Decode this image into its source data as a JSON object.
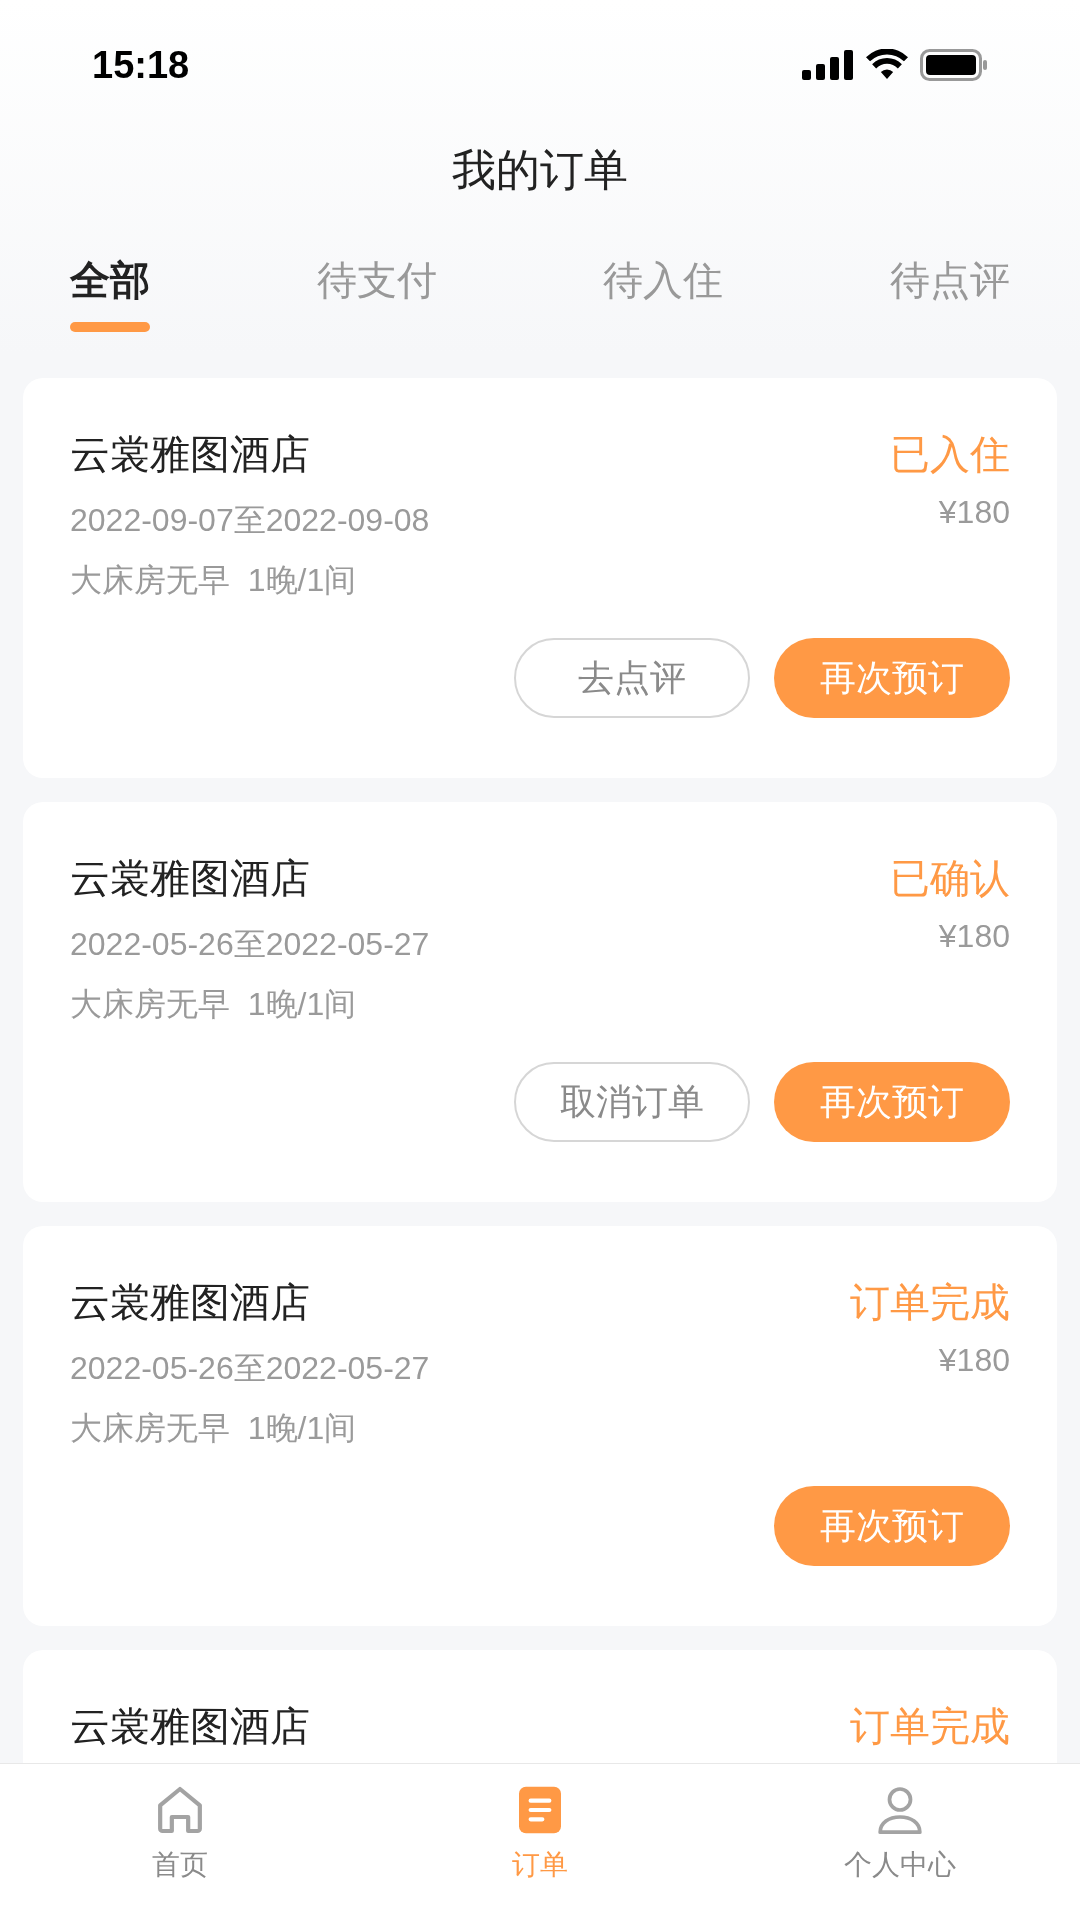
{
  "status_bar": {
    "time": "15:18"
  },
  "title": "我的订单",
  "tabs": [
    {
      "label": "全部",
      "selected": true
    },
    {
      "label": "待支付",
      "selected": false
    },
    {
      "label": "待入住",
      "selected": false
    },
    {
      "label": "待点评",
      "selected": false
    }
  ],
  "orders": [
    {
      "hotel": "云裳雅图酒店",
      "status": "已入住",
      "price": "¥180",
      "dates": "2022-09-07至2022-09-08",
      "room": "大床房无早  1晚/1间",
      "buttons": [
        {
          "label": "去点评",
          "kind": "outline"
        },
        {
          "label": "再次预订",
          "kind": "primary"
        }
      ]
    },
    {
      "hotel": "云裳雅图酒店",
      "status": "已确认",
      "price": "¥180",
      "dates": "2022-05-26至2022-05-27",
      "room": "大床房无早  1晚/1间",
      "buttons": [
        {
          "label": "取消订单",
          "kind": "outline"
        },
        {
          "label": "再次预订",
          "kind": "primary"
        }
      ]
    },
    {
      "hotel": "云裳雅图酒店",
      "status": "订单完成",
      "price": "¥180",
      "dates": "2022-05-26至2022-05-27",
      "room": "大床房无早  1晚/1间",
      "buttons": [
        {
          "label": "再次预订",
          "kind": "primary"
        }
      ]
    },
    {
      "hotel": "云裳雅图酒店",
      "status": "订单完成"
    }
  ],
  "nav": [
    {
      "label": "首页",
      "kind": "home",
      "selected": false
    },
    {
      "label": "订单",
      "kind": "orders",
      "selected": true
    },
    {
      "label": "个人中心",
      "kind": "profile",
      "selected": false
    }
  ]
}
